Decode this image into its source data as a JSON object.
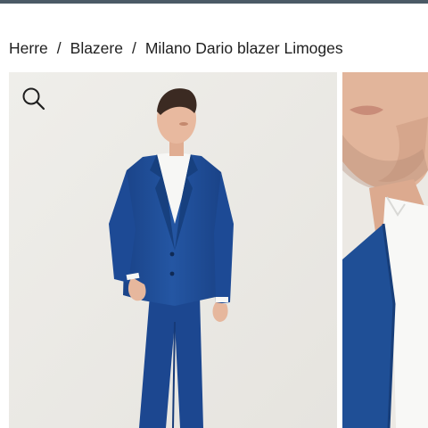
{
  "breadcrumb": {
    "items": [
      "Herre",
      "Blazere",
      "Milano Dario blazer Limoges"
    ],
    "separator": "/"
  },
  "gallery": {
    "zoom_icon": "search-icon"
  },
  "colors": {
    "top_bar": "#4b5a66",
    "suit_blue": "#1f4f96",
    "photo_background": "#ecebe7",
    "text": "#1f1f1f"
  }
}
